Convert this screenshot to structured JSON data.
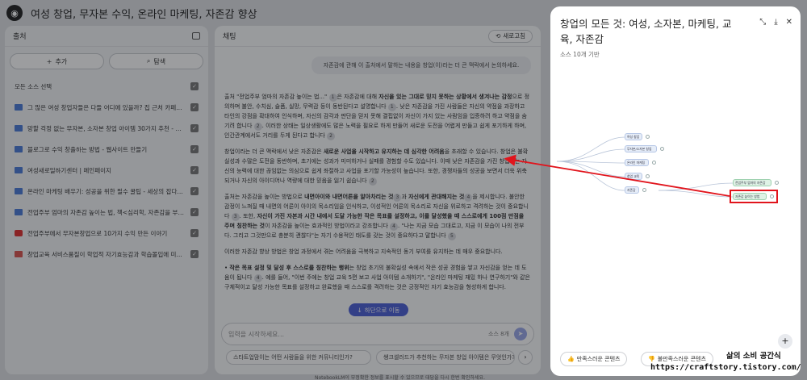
{
  "app": {
    "title": "여성 창업, 무자본 수익, 온라인 마케팅, 자존감 향상"
  },
  "sources_panel": {
    "header": "출처",
    "add_label": "추가",
    "discover_label": "탐색",
    "select_all_label": "모든 소스 선택",
    "items": [
      {
        "title": "그 많은 여성 창업자들은 다들 어디에 있을까? 집 근처 카페를 ...",
        "type": "doc"
      },
      {
        "title": "망할 걱정 없는 무자본, 소자본 창업 아이템 30가지 추천 - 쌩...",
        "type": "doc"
      },
      {
        "title": "블로그로 수익 창출하는 방법 - 웹사이트 만들기",
        "type": "doc"
      },
      {
        "title": "여성새로일하기센터 | 메인페이지",
        "type": "doc"
      },
      {
        "title": "온라인 마케팅 배우기: 성공을 위한 필수 꿀팁 - 세상의 잡다한...",
        "type": "doc"
      },
      {
        "title": "전업주부 엄마의 자존감 높이는 법, 책<심리학, 자존감을 부탁...",
        "type": "doc"
      },
      {
        "title": "전업주부에서 무자본창업으로 10가지 수익 만든 이야기",
        "type": "youtube"
      },
      {
        "title": "창업교육 서비스품질이 학업적 자기효능감과 학습몰입에 미치...",
        "type": "pdf"
      }
    ]
  },
  "chat_panel": {
    "header": "채팅",
    "refresh_label": "새로고침",
    "user_message": "자존감에 관해 이 출처에서 말하는 내용을 창업(이)라는 더 큰 맥락에서 논의하세요.",
    "answer": {
      "p1_a": "출처 \"전업주부 엄마의 자존감 높이는 법...\" ",
      "p1_cite1": "1",
      "p1_b": "은 자존감에 대해 ",
      "p1_bold1": "자신을 있는 그대로 믿지 못하는 상황에서 생겨나는 감정",
      "p1_c": "으로 정의하며 불안, 수치심, 슬픔, 실망, 무력감 등이 동반된다고 설명합니다 ",
      "p1_cite2": "1",
      "p1_d": ". 낮은 자존감을 가진 사람들은 자신의 약점을 과장하고 타인의 강점을 확대하여 인식하며, 자신의 감각과 판단을 믿지 못해 결핍없이 자신이 가지 있는 사람임을 입증하려 하고 약점을 숨기려 합니다 ",
      "p1_cite3": "2",
      "p1_e": ". 이러한 상태는 일상생활에도 많은 노력을 필요로 하게 만들어 새로운 도전을 어렵게 만들고 쉽게 포기하게 하며, 인간관계에서도 거리를 두게 된다고 합니다 ",
      "p1_cite4": "2",
      "p2_a": "창업이라는 더 큰 맥락에서 낮은 자존감은 ",
      "p2_bold1": "새로운 사업을 시작하고 유지하는 데 심각한 어려움",
      "p2_b": "을 초래할 수 있습니다. 창업은 불확실성과 수많은 도전을 동반하며, 초기에는 성과가 미미하거나 실패를 경험할 수도 있습니다. 이때 낮은 자존감을 가진 창업가는 자신의 능력에 대한 끊임없는 의심으로 쉽게 좌절하고 사업을 포기할 가능성이 높습니다. 또한, 경쟁자들의 성공을 보면서 더욱 위축되거나 자신의 아이디어나 역량에 대한 믿음을 잃기 쉽습니다 ",
      "p2_cite1": "2",
      "p3_a": "출처는 자존감을 높이는 방법으로 ",
      "p3_bold1": "내면아이와 내면어른을 알아차리는 것",
      "p3_cite1": "3",
      "p3_b": "과 ",
      "p3_bold2": "자신에게 관대해지는 것",
      "p3_cite2": "4",
      "p3_c": "을 제시합니다. 불안한 감정이 느껴질 때 내면의 어른이 아이의 목소리임을 인식하고, 이성적인 어른의 목소리로 자신을 위로하고 격려하는 것이 중요합니다 ",
      "p3_cite3": "3",
      "p3_d": ". 또한, ",
      "p3_bold3": "자신이 가진 자본과 시간 내에서 도달 가능한 작은 목표를 설정하고, 이를 달성했을 때 스스로에게 100점 만점을 주며 칭찬하는 것",
      "p3_e": "이 자존감을 높이는 효과적인 방법이라고 강조합니다 ",
      "p3_cite4": "4",
      "p3_f": ". \"나는 지금 모습 그대로고, 지금 이 모습이 나의 전부다. 그리고 그것만으로 충분히 괜찮다\"는 자기 수용적인 태도를 갖는 것이 중요하다고 말합니다 ",
      "p3_cite5": "5",
      "p4": "이러한 자존감 향상 방법은 창업 과정에서 겪는 어려움을 극복하고 지속적인 동기 부여를 유지하는 데 매우 중요합니다.",
      "p5_bold1": "작은 목표 설정 및 달성 후 스스로를 칭찬하는 행위",
      "p5_a": "는 창업 초기의 불확실성 속에서 작은 성공 경험을 쌓고 자신감을 얻는 데 도움이 됩니다 ",
      "p5_cite1": "4",
      "p5_b": ". 예를 들어, \"이번 주에는 창업 교육 5편 보고 사업 아이템 소개하기\", \"온라인 마케팅 재밌 하나 연구하기\"와 같은 구체적이고 달성 가능한 목표를 설정하고 완료했을 때 스스로를 격려하는 것은 긍정적인 자기 효능감을 형성하게 합니다."
    },
    "scroll_down_label": "하단으로 이동",
    "input_placeholder": "입력을 시작하세요...",
    "source_count": "소스 8개",
    "suggestions": [
      "스타트업맘이는 어떤 사람들을 위한 커뮤니티인가?",
      "쌩크셀러드가 추천하는 무자본 창업 아이템은 무엇인가?"
    ],
    "footer_note": "NotebookLM이 부정확한 정보를 표시할 수 있으므로 대답을 다시 한번 확인하세요."
  },
  "mindmap": {
    "title": "창업의 모든 것: 여성, 소자본, 마케팅, 교육, 자존감",
    "subtitle": "소스 10개 기반",
    "nodes": [
      {
        "id": "n1",
        "label": "여성 창업"
      },
      {
        "id": "n2",
        "label": "무자본/소자본 창업"
      },
      {
        "id": "n3",
        "label": "온라인 마케팅"
      },
      {
        "id": "n4",
        "label": "창업 교육"
      },
      {
        "id": "n5",
        "label": "자존감"
      },
      {
        "id": "n6",
        "label": "전업주부 엄마의 자존감"
      },
      {
        "id": "n7",
        "label": "자존감 높이는 방법"
      }
    ],
    "feedback_good": "만족스러운 콘텐츠",
    "feedback_bad": "불만족스러운 콘텐츠"
  },
  "watermark": {
    "line1": "삶의 소비 공간식",
    "line2": "https://craftstory.tistory.com/"
  },
  "colors": {
    "accent": "#4a5fd6",
    "highlight": "#e1141c"
  }
}
